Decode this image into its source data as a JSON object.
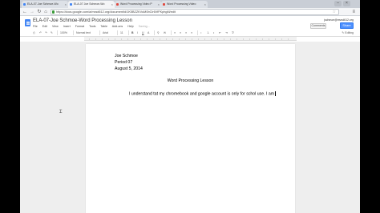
{
  "browser": {
    "tabs": [
      {
        "label": "ELA-07-Joe Schmoe-Wo",
        "favicon_color": "#4285f4",
        "active": false
      },
      {
        "label": "ELA-07 Joe Schmoe-Wo",
        "favicon_color": "#4285f4",
        "active": true
      },
      {
        "label": "Word Processing Video P",
        "favicon_color": "#e0483e",
        "active": false
      },
      {
        "label": "Word Processing Video",
        "favicon_color": "#e0483e",
        "active": false
      }
    ],
    "address": "https://docs.google.com/a/mvsd612.org/document/d/1K5BZZKVuM0bCIr6VfFKphgM/edit"
  },
  "docs": {
    "title": "ELA-07-Joe Schmoe-Word Processing Lesson",
    "user_email": "jschmoe@mvsd612.org",
    "menu": [
      "File",
      "Edit",
      "View",
      "Insert",
      "Format",
      "Tools",
      "Table",
      "Add-ons",
      "Help"
    ],
    "save_status": "Saving...",
    "comments_label": "Comments",
    "share_label": "Share",
    "editing_mode": "Editing",
    "toolbar": {
      "zoom": "100%",
      "style": "Normal text",
      "font": "Arial",
      "size": "11"
    }
  },
  "document": {
    "lines": [
      "Joe Schmoe",
      "Period 07",
      "August 5, 2014"
    ],
    "heading": "Word Processing Lesson",
    "body": "I understand tat my chromebook and google account is only for schol use. I am"
  }
}
